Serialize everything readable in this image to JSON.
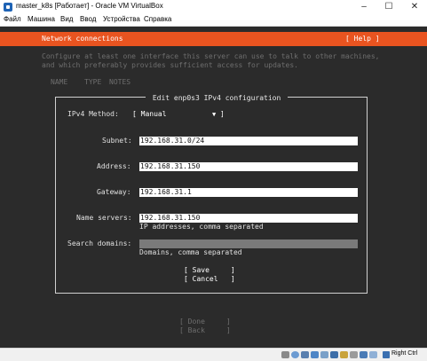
{
  "window": {
    "title": "master_k8s [Работает] - Oracle VM VirtualBox",
    "minimize_glyph": "–",
    "maximize_glyph": "☐",
    "close_glyph": "✕"
  },
  "menu": [
    "Файл",
    "Машина",
    "Вид",
    "Ввод",
    "Устройства",
    "Справка"
  ],
  "installer": {
    "header_title": "Network connections",
    "help_label": "[ Help ]",
    "intro_lines": [
      "Configure at least one interface this server can use to talk to other machines,",
      "and which preferably provides sufficient access for updates."
    ],
    "columns": [
      "NAME",
      "TYPE",
      "NOTES"
    ]
  },
  "dialog": {
    "title": " Edit enp0s3 IPv4 configuration ",
    "method_label": "IPv4 Method:",
    "method_value": "[ Manual",
    "method_close": "]",
    "method_caret": "▼",
    "subnet_label": "Subnet:",
    "subnet_value": "192.168.31.0/24",
    "address_label": "Address:",
    "address_value": "192.168.31.150",
    "gateway_label": "Gateway:",
    "gateway_value": "192.168.31.1",
    "nameservers_label": "Name servers:",
    "nameservers_value": "192.168.31.150",
    "nameservers_hint": "IP addresses, comma separated",
    "searchdomains_label": "Search domains:",
    "searchdomains_value": "",
    "searchdomains_hint": "Domains, comma separated",
    "save_label": "[ Save     ]",
    "cancel_label": "[ Cancel   ]"
  },
  "footer": {
    "done_label": "[ Done     ]",
    "back_label": "[ Back     ]"
  },
  "statusbar": {
    "host_key": "Right Ctrl",
    "icons": [
      "hdd-icon",
      "cd-icon",
      "usb-icon",
      "network-icon",
      "audio-icon",
      "display-icon",
      "shared-folder-icon",
      "recording-icon",
      "cpu-icon",
      "mouse-icon",
      "keyboard-icon"
    ]
  },
  "colors": {
    "header": "#e95420",
    "console_bg": "#2b2b2b",
    "field_bg": "#ffffff",
    "empty_field_bg": "#7a7a7a"
  }
}
